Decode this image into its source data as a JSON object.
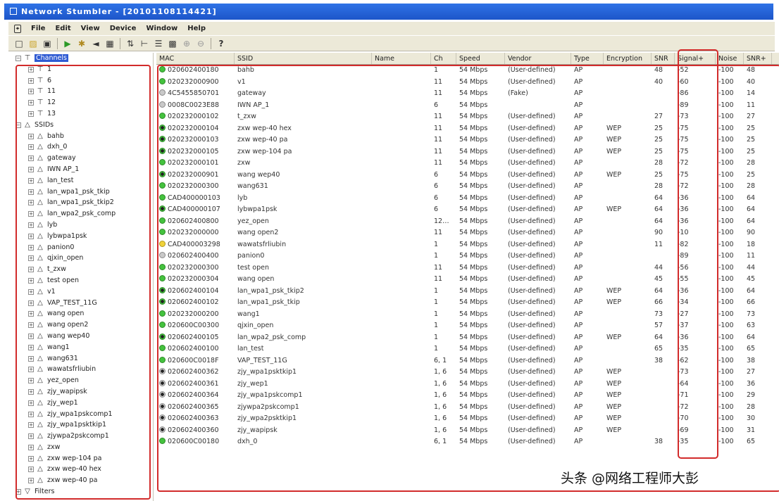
{
  "window": {
    "title": "Network Stumbler - [20101108114421]"
  },
  "menu": [
    "File",
    "Edit",
    "View",
    "Device",
    "Window",
    "Help"
  ],
  "toolbar_icons": [
    "new-icon",
    "open-icon",
    "save-icon",
    "play-icon",
    "scan-icon",
    "speaker-icon",
    "config-icon",
    "sort-icon",
    "filter-icon",
    "list-icon",
    "grid-icon",
    "zoom-icon",
    "zoom-out-icon",
    "help-icon"
  ],
  "tree": {
    "root": "Channels",
    "channels": [
      "1",
      "6",
      "11",
      "12",
      "13"
    ],
    "ssids_label": "SSIDs",
    "ssids": [
      "bahb",
      "dxh_0",
      "gateway",
      "IWN AP_1",
      "lan_test",
      "lan_wpa1_psk_tkip",
      "lan_wpa1_psk_tkip2",
      "lan_wpa2_psk_comp",
      "lyb",
      "lybwpa1psk",
      "panion0",
      "qjxin_open",
      "t_zxw",
      "test open",
      "v1",
      "VAP_TEST_11G",
      "wang open",
      "wang open2",
      "wang wep40",
      "wang1",
      "wang631",
      "wawatsfrliubin",
      "yez_open",
      "zjy_wapipsk",
      "zjy_wep1",
      "zjy_wpa1pskcomp1",
      "zjy_wpa1psktkip1",
      "zjywpa2pskcomp1",
      "zxw",
      "zxw wep-104 pa",
      "zxw wep-40 hex",
      "zxw wep-40 pa"
    ],
    "filters_label": "Filters"
  },
  "columns": [
    "MAC",
    "SSID",
    "Name",
    "Ch",
    "Speed",
    "Vendor",
    "Type",
    "Encryption",
    "SNR",
    "Signal+",
    "Noise",
    "SNR+"
  ],
  "rows": [
    {
      "mac": "020602400180",
      "ssid": "bahb",
      "ch": "1",
      "speed": "54 Mbps",
      "vendor": "(User-defined)",
      "type": "AP",
      "enc": "",
      "snr": "48",
      "signal": "-52",
      "noise": "-100",
      "snr2": "48",
      "dot": "green"
    },
    {
      "mac": "020232000900",
      "ssid": "v1",
      "ch": "11",
      "speed": "54 Mbps",
      "vendor": "(User-defined)",
      "type": "AP",
      "enc": "",
      "snr": "40",
      "signal": "-60",
      "noise": "-100",
      "snr2": "40",
      "dot": "green"
    },
    {
      "mac": "4C5455850701",
      "ssid": "gateway",
      "ch": "11",
      "speed": "54 Mbps",
      "vendor": "(Fake)",
      "type": "AP",
      "enc": "",
      "snr": "",
      "signal": "-86",
      "noise": "-100",
      "snr2": "14",
      "dot": "gray"
    },
    {
      "mac": "0008C0023E88",
      "ssid": "IWN AP_1",
      "ch": "6",
      "speed": "54 Mbps",
      "vendor": "",
      "type": "AP",
      "enc": "",
      "snr": "",
      "signal": "-89",
      "noise": "-100",
      "snr2": "11",
      "dot": "gray"
    },
    {
      "mac": "020232000102",
      "ssid": "t_zxw",
      "ch": "11",
      "speed": "54 Mbps",
      "vendor": "(User-defined)",
      "type": "AP",
      "enc": "",
      "snr": "27",
      "signal": "-73",
      "noise": "-100",
      "snr2": "27",
      "dot": "green"
    },
    {
      "mac": "020232000104",
      "ssid": "zxw wep-40 hex",
      "ch": "11",
      "speed": "54 Mbps",
      "vendor": "(User-defined)",
      "type": "AP",
      "enc": "WEP",
      "snr": "25",
      "signal": "-75",
      "noise": "-100",
      "snr2": "25",
      "dot": "lock"
    },
    {
      "mac": "020232000103",
      "ssid": "zxw wep-40 pa",
      "ch": "11",
      "speed": "54 Mbps",
      "vendor": "(User-defined)",
      "type": "AP",
      "enc": "WEP",
      "snr": "25",
      "signal": "-75",
      "noise": "-100",
      "snr2": "25",
      "dot": "lock"
    },
    {
      "mac": "020232000105",
      "ssid": "zxw wep-104 pa",
      "ch": "11",
      "speed": "54 Mbps",
      "vendor": "(User-defined)",
      "type": "AP",
      "enc": "WEP",
      "snr": "25",
      "signal": "-75",
      "noise": "-100",
      "snr2": "25",
      "dot": "lock"
    },
    {
      "mac": "020232000101",
      "ssid": "zxw",
      "ch": "11",
      "speed": "54 Mbps",
      "vendor": "(User-defined)",
      "type": "AP",
      "enc": "",
      "snr": "28",
      "signal": "-72",
      "noise": "-100",
      "snr2": "28",
      "dot": "green"
    },
    {
      "mac": "020232000901",
      "ssid": "wang wep40",
      "ch": "6",
      "speed": "54 Mbps",
      "vendor": "(User-defined)",
      "type": "AP",
      "enc": "WEP",
      "snr": "25",
      "signal": "-75",
      "noise": "-100",
      "snr2": "25",
      "dot": "lock"
    },
    {
      "mac": "020232000300",
      "ssid": "wang631",
      "ch": "6",
      "speed": "54 Mbps",
      "vendor": "(User-defined)",
      "type": "AP",
      "enc": "",
      "snr": "28",
      "signal": "-72",
      "noise": "-100",
      "snr2": "28",
      "dot": "green"
    },
    {
      "mac": "CAD400000103",
      "ssid": "lyb",
      "ch": "6",
      "speed": "54 Mbps",
      "vendor": "(User-defined)",
      "type": "AP",
      "enc": "",
      "snr": "64",
      "signal": "-36",
      "noise": "-100",
      "snr2": "64",
      "dot": "green"
    },
    {
      "mac": "CAD400000107",
      "ssid": "lybwpa1psk",
      "ch": "6",
      "speed": "54 Mbps",
      "vendor": "(User-defined)",
      "type": "AP",
      "enc": "WEP",
      "snr": "64",
      "signal": "-36",
      "noise": "-100",
      "snr2": "64",
      "dot": "lock"
    },
    {
      "mac": "020602400800",
      "ssid": "yez_open",
      "ch": "12…",
      "speed": "54 Mbps",
      "vendor": "(User-defined)",
      "type": "AP",
      "enc": "",
      "snr": "64",
      "signal": "-36",
      "noise": "-100",
      "snr2": "64",
      "dot": "green"
    },
    {
      "mac": "020232000000",
      "ssid": "wang open2",
      "ch": "11",
      "speed": "54 Mbps",
      "vendor": "(User-defined)",
      "type": "AP",
      "enc": "",
      "snr": "90",
      "signal": "-10",
      "noise": "-100",
      "snr2": "90",
      "dot": "green"
    },
    {
      "mac": "CAD400003298",
      "ssid": "wawatsfrliubin",
      "ch": "1",
      "speed": "54 Mbps",
      "vendor": "(User-defined)",
      "type": "AP",
      "enc": "",
      "snr": "11",
      "signal": "-82",
      "noise": "-100",
      "snr2": "18",
      "dot": "yellow"
    },
    {
      "mac": "020602400400",
      "ssid": "panion0",
      "ch": "1",
      "speed": "54 Mbps",
      "vendor": "(User-defined)",
      "type": "AP",
      "enc": "",
      "snr": "",
      "signal": "-89",
      "noise": "-100",
      "snr2": "11",
      "dot": "gray"
    },
    {
      "mac": "020232000300",
      "ssid": "test open",
      "ch": "11",
      "speed": "54 Mbps",
      "vendor": "(User-defined)",
      "type": "AP",
      "enc": "",
      "snr": "44",
      "signal": "-56",
      "noise": "-100",
      "snr2": "44",
      "dot": "green"
    },
    {
      "mac": "020232000304",
      "ssid": "wang open",
      "ch": "11",
      "speed": "54 Mbps",
      "vendor": "(User-defined)",
      "type": "AP",
      "enc": "",
      "snr": "45",
      "signal": "-55",
      "noise": "-100",
      "snr2": "45",
      "dot": "green"
    },
    {
      "mac": "020602400104",
      "ssid": "lan_wpa1_psk_tkip2",
      "ch": "1",
      "speed": "54 Mbps",
      "vendor": "(User-defined)",
      "type": "AP",
      "enc": "WEP",
      "snr": "64",
      "signal": "-36",
      "noise": "-100",
      "snr2": "64",
      "dot": "lock"
    },
    {
      "mac": "020602400102",
      "ssid": "lan_wpa1_psk_tkip",
      "ch": "1",
      "speed": "54 Mbps",
      "vendor": "(User-defined)",
      "type": "AP",
      "enc": "WEP",
      "snr": "66",
      "signal": "-34",
      "noise": "-100",
      "snr2": "66",
      "dot": "lock"
    },
    {
      "mac": "020232000200",
      "ssid": "wang1",
      "ch": "1",
      "speed": "54 Mbps",
      "vendor": "(User-defined)",
      "type": "AP",
      "enc": "",
      "snr": "73",
      "signal": "-27",
      "noise": "-100",
      "snr2": "73",
      "dot": "green"
    },
    {
      "mac": "020600C00300",
      "ssid": "qjxin_open",
      "ch": "1",
      "speed": "54 Mbps",
      "vendor": "(User-defined)",
      "type": "AP",
      "enc": "",
      "snr": "57",
      "signal": "-37",
      "noise": "-100",
      "snr2": "63",
      "dot": "green"
    },
    {
      "mac": "020602400105",
      "ssid": "lan_wpa2_psk_comp",
      "ch": "1",
      "speed": "54 Mbps",
      "vendor": "(User-defined)",
      "type": "AP",
      "enc": "WEP",
      "snr": "64",
      "signal": "-36",
      "noise": "-100",
      "snr2": "64",
      "dot": "lock"
    },
    {
      "mac": "020602400100",
      "ssid": "lan_test",
      "ch": "1",
      "speed": "54 Mbps",
      "vendor": "(User-defined)",
      "type": "AP",
      "enc": "",
      "snr": "65",
      "signal": "-35",
      "noise": "-100",
      "snr2": "65",
      "dot": "green"
    },
    {
      "mac": "020600C0018F",
      "ssid": "VAP_TEST_11G",
      "ch": "6, 1",
      "speed": "54 Mbps",
      "vendor": "(User-defined)",
      "type": "AP",
      "enc": "",
      "snr": "38",
      "signal": "-62",
      "noise": "-100",
      "snr2": "38",
      "dot": "green"
    },
    {
      "mac": "020602400362",
      "ssid": "zjy_wpa1psktkip1",
      "ch": "1, 6",
      "speed": "54 Mbps",
      "vendor": "(User-defined)",
      "type": "AP",
      "enc": "WEP",
      "snr": "",
      "signal": "-73",
      "noise": "-100",
      "snr2": "27",
      "dot": "lockgray"
    },
    {
      "mac": "020602400361",
      "ssid": "zjy_wep1",
      "ch": "1, 6",
      "speed": "54 Mbps",
      "vendor": "(User-defined)",
      "type": "AP",
      "enc": "WEP",
      "snr": "",
      "signal": "-64",
      "noise": "-100",
      "snr2": "36",
      "dot": "lockgray"
    },
    {
      "mac": "020602400364",
      "ssid": "zjy_wpa1pskcomp1",
      "ch": "1, 6",
      "speed": "54 Mbps",
      "vendor": "(User-defined)",
      "type": "AP",
      "enc": "WEP",
      "snr": "",
      "signal": "-71",
      "noise": "-100",
      "snr2": "29",
      "dot": "lockgray"
    },
    {
      "mac": "020602400365",
      "ssid": "zjywpa2pskcomp1",
      "ch": "1, 6",
      "speed": "54 Mbps",
      "vendor": "(User-defined)",
      "type": "AP",
      "enc": "WEP",
      "snr": "",
      "signal": "-72",
      "noise": "-100",
      "snr2": "28",
      "dot": "lockgray"
    },
    {
      "mac": "020602400363",
      "ssid": "zjy_wpa2psktkip1",
      "ch": "1, 6",
      "speed": "54 Mbps",
      "vendor": "(User-defined)",
      "type": "AP",
      "enc": "WEP",
      "snr": "",
      "signal": "-70",
      "noise": "-100",
      "snr2": "30",
      "dot": "lockgray"
    },
    {
      "mac": "020602400360",
      "ssid": "zjy_wapipsk",
      "ch": "1, 6",
      "speed": "54 Mbps",
      "vendor": "(User-defined)",
      "type": "AP",
      "enc": "WEP",
      "snr": "",
      "signal": "-69",
      "noise": "-100",
      "snr2": "31",
      "dot": "lockgray"
    },
    {
      "mac": "020600C00180",
      "ssid": "dxh_0",
      "ch": "6, 1",
      "speed": "54 Mbps",
      "vendor": "(User-defined)",
      "type": "AP",
      "enc": "",
      "snr": "38",
      "signal": "-35",
      "noise": "-100",
      "snr2": "65",
      "dot": "green"
    }
  ],
  "watermark": "头条 @网络工程师大彭",
  "colors": {
    "highlight_box": "#d22b2b",
    "titlebar": "#2f73e6",
    "selection": "#2f5bd3"
  }
}
